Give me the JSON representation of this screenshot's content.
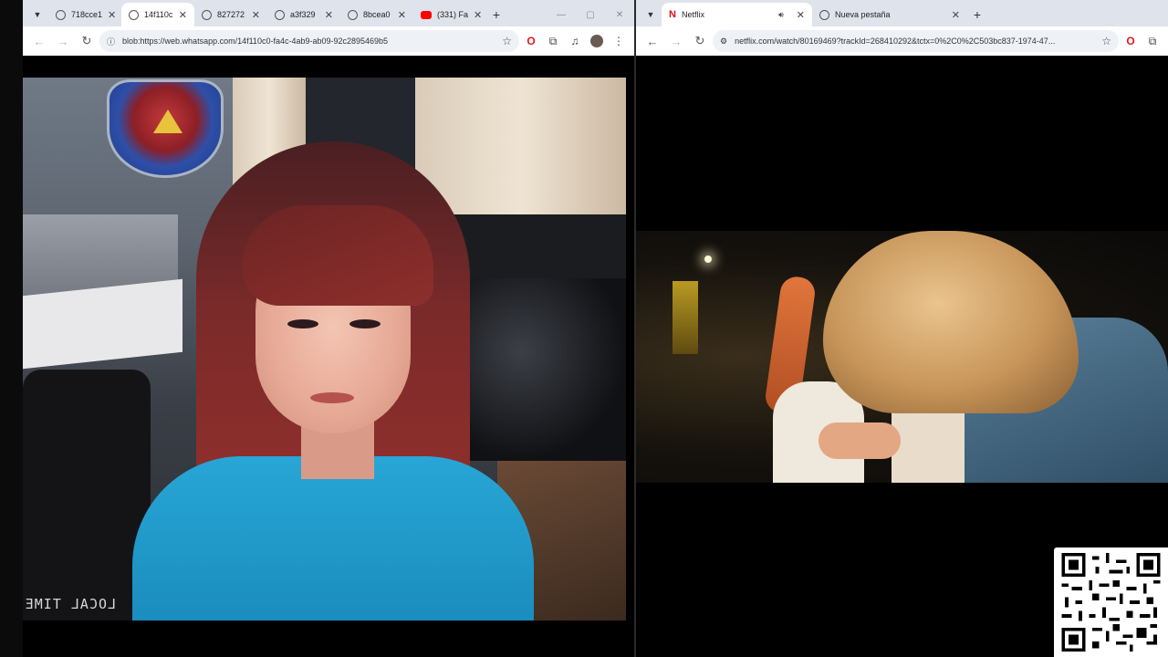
{
  "left_window": {
    "tabs": [
      {
        "label": "718cce1",
        "favicon": "globe-icon",
        "active": false
      },
      {
        "label": "14f110c",
        "favicon": "globe-icon",
        "active": true
      },
      {
        "label": "827272",
        "favicon": "globe-icon",
        "active": false
      },
      {
        "label": "a3f329",
        "favicon": "globe-icon",
        "active": false
      },
      {
        "label": "8bcea0",
        "favicon": "globe-icon",
        "active": false
      },
      {
        "label": "(331) Fa",
        "favicon": "youtube-icon",
        "active": false
      }
    ],
    "url": "blob:https://web.whatsapp.com/14f110c0-fa4c-4ab9-ab09-92c2895469b5",
    "overlay_text": "LOCAL TIME"
  },
  "right_window": {
    "tabs": [
      {
        "label": "Netflix",
        "favicon": "netflix-icon",
        "active": true,
        "audio": true
      },
      {
        "label": "Nueva pestaña",
        "favicon": "globe-icon",
        "active": false
      }
    ],
    "url": "netflix.com/watch/80169469?trackId=268410292&tctx=0%2C0%2C503bc837-1974-47..."
  },
  "colors": {
    "tabbar_bg": "#dfe3eb",
    "toolbar_bg": "#ffffff",
    "omnibox_bg": "#eef1f6",
    "netflix_red": "#e50914",
    "shirt_blue": "#28a6d6"
  }
}
